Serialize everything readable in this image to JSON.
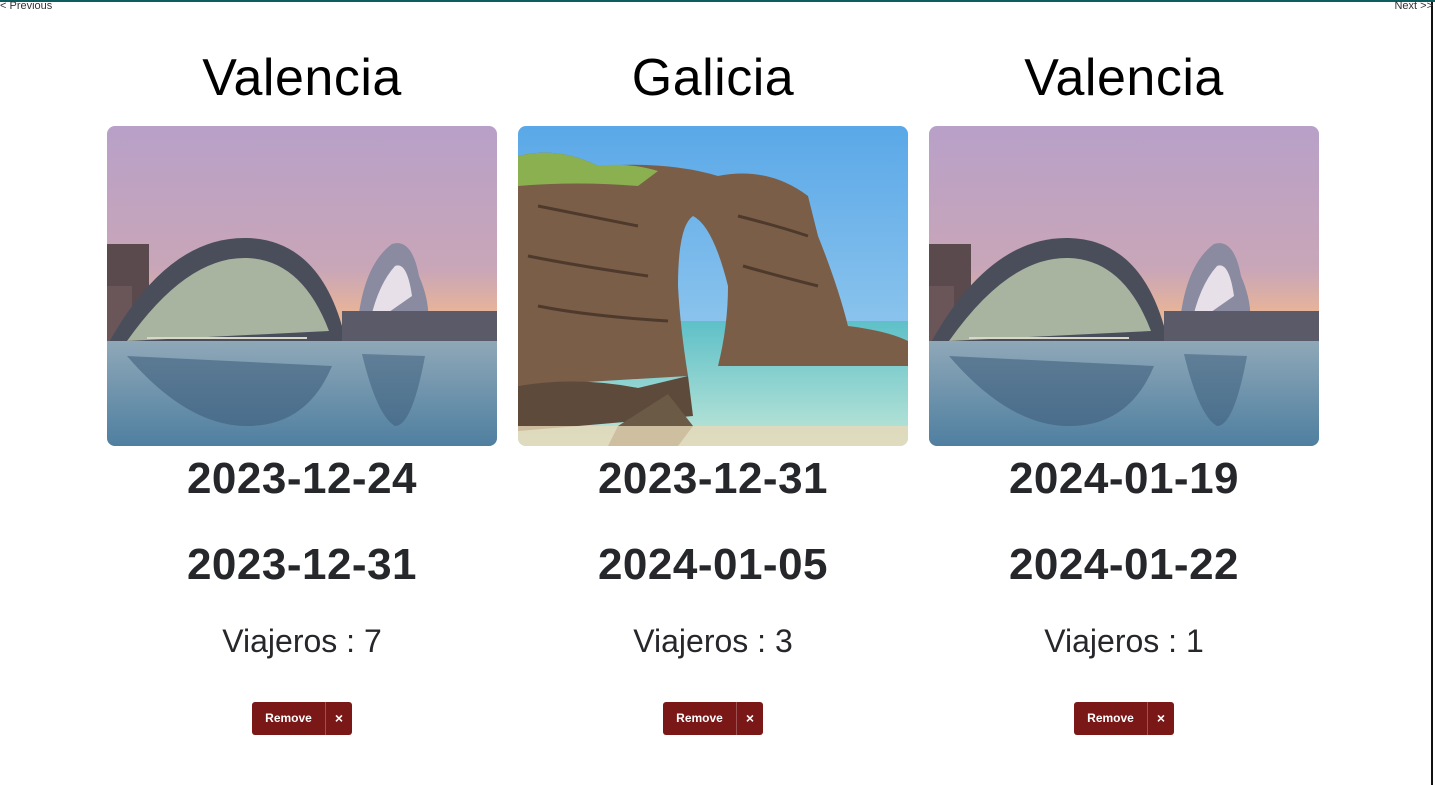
{
  "nav": {
    "previous": "< Previous",
    "next": "Next >>"
  },
  "trips": [
    {
      "destination": "Valencia",
      "start_date": "2023-12-24",
      "end_date": "2023-12-31",
      "travelers": "Viajeros : 7",
      "remove_label": "Remove",
      "remove_icon": "×",
      "image": "valencia-city-of-arts-and-sciences"
    },
    {
      "destination": "Galicia",
      "start_date": "2023-12-31",
      "end_date": "2024-01-05",
      "travelers": "Viajeros : 3",
      "remove_label": "Remove",
      "remove_icon": "×",
      "image": "galicia-rock-arch-beach"
    },
    {
      "destination": "Valencia",
      "start_date": "2024-01-19",
      "end_date": "2024-01-22",
      "travelers": "Viajeros : 1",
      "remove_label": "Remove",
      "remove_icon": "×",
      "image": "valencia-city-of-arts-and-sciences"
    }
  ],
  "colors": {
    "remove_button": "#7a1717",
    "top_border": "#0f5c5c"
  }
}
